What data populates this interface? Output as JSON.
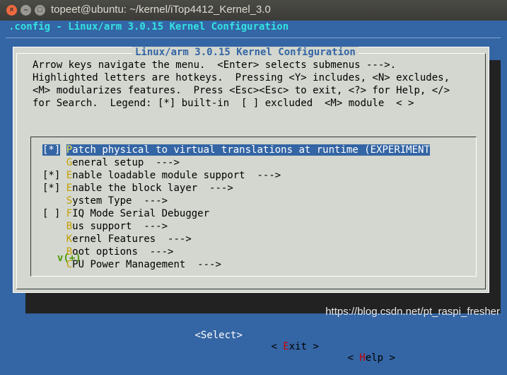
{
  "window": {
    "title": "topeet@ubuntu: ~/kernel/iTop4412_Kernel_3.0",
    "controls": [
      "close-icon",
      "minimize-icon",
      "maximize-icon"
    ]
  },
  "terminal": {
    "header": ".config - Linux/arm 3.0.15 Kernel Configuration"
  },
  "dialog": {
    "title": "Linux/arm 3.0.15 Kernel Configuration",
    "help_lines": [
      "Arrow keys navigate the menu.  <Enter> selects submenus --->.",
      "Highlighted letters are hotkeys.  Pressing <Y> includes, <N> excludes,",
      "<M> modularizes features.  Press <Esc><Esc> to exit, <?> for Help, </>",
      "for Search.  Legend: [*] built-in  [ ] excluded  <M> module  < >"
    ],
    "menu": [
      {
        "prefix": "[*]",
        "hot": "P",
        "rest": "atch physical to virtual translations at runtime (EXPERIMENT",
        "selected": true
      },
      {
        "prefix": "   ",
        "hot": "G",
        "rest": "eneral setup  --->"
      },
      {
        "prefix": "[*]",
        "hot": "E",
        "rest": "nable loadable module support  --->"
      },
      {
        "prefix": "[*]",
        "hot": "E",
        "rest": "nable the block layer  --->"
      },
      {
        "prefix": "   ",
        "hot": "S",
        "rest": "ystem Type  --->"
      },
      {
        "prefix": "[ ]",
        "hot": "F",
        "rest": "IQ Mode Serial Debugger"
      },
      {
        "prefix": "   ",
        "hot": "B",
        "rest": "us support  --->"
      },
      {
        "prefix": "   ",
        "hot": "K",
        "rest": "ernel Features  --->"
      },
      {
        "prefix": "   ",
        "hot": "B",
        "rest": "oot options  --->"
      },
      {
        "prefix": "   ",
        "hot": "C",
        "rest": "PU Power Management  --->"
      }
    ],
    "more_indicator": "v(+)",
    "buttons": {
      "select": {
        "open": "<",
        "hot": "S",
        "rest": "elect",
        "close": ">"
      },
      "exit": {
        "open": "< ",
        "hot": "E",
        "rest": "xit",
        "close": " >"
      },
      "help": {
        "open": "< ",
        "hot": "H",
        "rest": "elp",
        "close": " >"
      }
    }
  },
  "watermark": "https://blog.csdn.net/pt_raspi_fresher"
}
